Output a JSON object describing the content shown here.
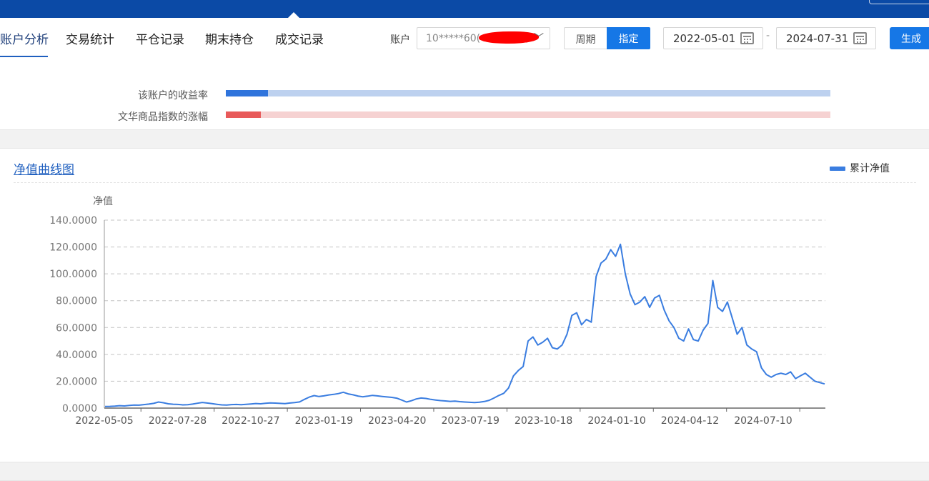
{
  "tabs": [
    {
      "label": "账户分析",
      "active": true
    },
    {
      "label": "交易统计",
      "active": false
    },
    {
      "label": "平仓记录",
      "active": false
    },
    {
      "label": "期末持仓",
      "active": false
    },
    {
      "label": "成交记录",
      "active": false
    }
  ],
  "filters": {
    "account_label": "账户",
    "account_value": "10*****60(",
    "period_label": "周期",
    "specify_label": "指定",
    "date_from": "2022-05-01",
    "date_separator": "-",
    "date_to": "2024-07-31",
    "generate_label": "生成"
  },
  "comparison": {
    "account_return_label": "该账户的收益率",
    "account_return_fill": 0.07,
    "account_color": "#2f74dc",
    "account_track_color": "#bdd1ef",
    "index_change_label": "文华商品指数的涨幅",
    "index_change_fill": 0.058,
    "index_color": "#e85a5a",
    "index_track_color": "#f6d2d2"
  },
  "chart_title": "净值曲线图",
  "legend_label": "累计净值",
  "chart_data": {
    "type": "line",
    "ylabel": "净值",
    "ylim": [
      0,
      140
    ],
    "yticks": [
      "0.0000",
      "20.0000",
      "40.0000",
      "60.0000",
      "80.0000",
      "100.0000",
      "120.0000",
      "140.0000"
    ],
    "xticks": [
      "2022-05-05",
      "2022-07-28",
      "2022-10-27",
      "2023-01-19",
      "2023-04-20",
      "2023-07-19",
      "2023-10-18",
      "2024-01-10",
      "2024-04-12",
      "2024-07-10"
    ],
    "grid": true,
    "series": [
      {
        "name": "累计净值",
        "color": "#3a7de0",
        "values": [
          1.2,
          1.3,
          1.5,
          1.8,
          1.6,
          2.0,
          2.3,
          2.2,
          2.6,
          3.0,
          3.5,
          4.5,
          4.0,
          3.2,
          2.9,
          2.7,
          2.4,
          2.5,
          3.0,
          3.6,
          4.2,
          3.8,
          3.3,
          2.8,
          2.4,
          2.3,
          2.6,
          2.7,
          2.5,
          2.8,
          3.1,
          3.4,
          3.2,
          3.6,
          3.9,
          3.7,
          3.5,
          3.3,
          3.8,
          4.1,
          4.6,
          6.5,
          8.2,
          9.3,
          8.6,
          9.1,
          9.8,
          10.2,
          10.8,
          11.8,
          10.6,
          9.9,
          9.0,
          8.4,
          8.9,
          9.5,
          9.1,
          8.7,
          8.3,
          8.0,
          7.4,
          6.0,
          4.5,
          5.5,
          6.8,
          7.5,
          7.2,
          6.5,
          6.0,
          5.6,
          5.3,
          5.0,
          5.2,
          4.8,
          4.5,
          4.3,
          4.1,
          4.4,
          4.9,
          5.8,
          7.5,
          9.4,
          11.0,
          15.0,
          24.0,
          28.0,
          31.0,
          50.0,
          53.0,
          47.0,
          49.0,
          52.0,
          45.0,
          44.0,
          47.0,
          55.0,
          69.0,
          71.0,
          62.0,
          66.0,
          64.0,
          98.0,
          108.0,
          111.0,
          118.0,
          113.0,
          122.0,
          100.0,
          85.0,
          77.0,
          79.0,
          83.0,
          75.0,
          82.0,
          84.0,
          73.0,
          65.0,
          60.0,
          52.0,
          50.0,
          59.0,
          51.0,
          50.0,
          58.0,
          63.0,
          95.0,
          75.0,
          72.0,
          79.0,
          67.0,
          55.0,
          60.0,
          47.0,
          44.0,
          42.0,
          30.0,
          25.0,
          23.0,
          25.0,
          26.0,
          25.0,
          27.0,
          22.0,
          24.0,
          26.0,
          23.0,
          20.0,
          19.0,
          18.0
        ]
      }
    ]
  }
}
